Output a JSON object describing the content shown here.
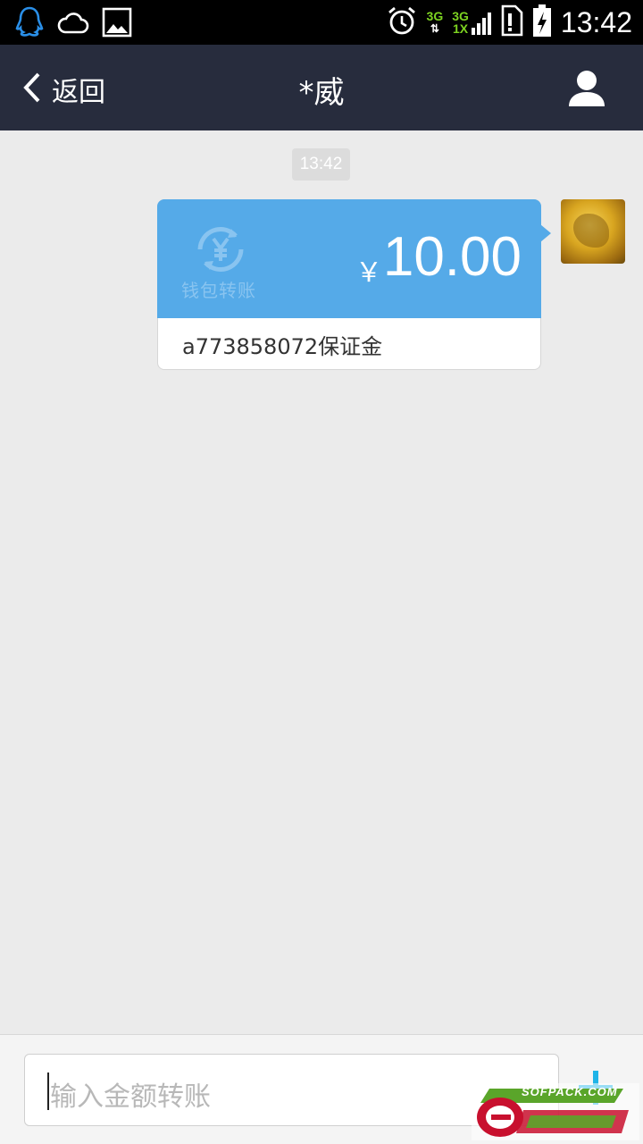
{
  "status_bar": {
    "time": "13:42",
    "network_1": "3G",
    "network_2_top": "3G",
    "network_2_bottom": "1X",
    "icons": [
      "qq-icon",
      "cloud-icon",
      "gallery-icon",
      "alarm-icon",
      "signal-icon",
      "sim-alert-icon",
      "battery-charging-icon"
    ]
  },
  "header": {
    "back_label": "返回",
    "title": "*威",
    "profile_icon": "profile-icon"
  },
  "chat": {
    "timestamp": "13:42",
    "transfer_card": {
      "wallet_label": "钱包转账",
      "currency_symbol": "￥",
      "amount": "10.00",
      "note": "a773858072保证金"
    }
  },
  "input": {
    "placeholder": "输入金额转账"
  },
  "watermark": {
    "text": "SOFPACK.COM"
  },
  "colors": {
    "header_bg": "#272c3d",
    "card_blue": "#55aae8",
    "chat_bg": "#ebebeb",
    "plus_accent": "#1fb4e8"
  }
}
